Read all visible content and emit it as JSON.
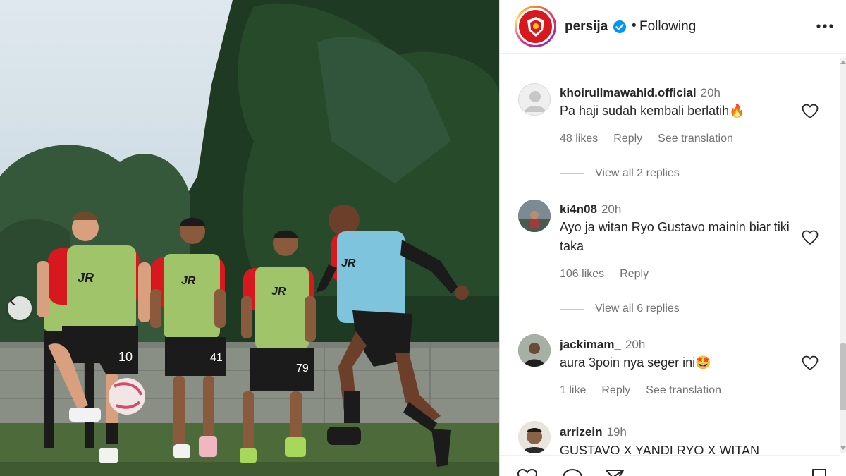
{
  "photo": {
    "alt_jersey_brand": "JR",
    "player_numbers": [
      "10",
      "41",
      "79"
    ]
  },
  "carousel": {
    "prev_icon": "chevron-left-icon"
  },
  "post_header": {
    "username": "persija",
    "verified_icon": "verified-badge-icon",
    "separator": "•",
    "follow_status": "Following",
    "more_icon": "more-horizontal-icon",
    "brand_color": "#d7191f"
  },
  "comments": [
    {
      "username": "khoirullmawahid.official",
      "time": "20h",
      "text": "Pa haji sudah kembali berlatih🔥",
      "likes": "48 likes",
      "reply": "Reply",
      "translation": "See translation",
      "view_replies": "View all 2 replies",
      "avatar": "default-avatar-icon"
    },
    {
      "username": "ki4n08",
      "time": "20h",
      "text": "Ayo ja witan Ryo Gustavo mainin biar tiki taka",
      "likes": "106 likes",
      "reply": "Reply",
      "view_replies": "View all 6 replies",
      "avatar": "photo-avatar"
    },
    {
      "username": "jackimam_",
      "time": "20h",
      "text": "aura 3poin nya seger ini🤩",
      "likes": "1 like",
      "reply": "Reply",
      "translation": "See translation",
      "avatar": "photo-avatar"
    },
    {
      "username": "arrizein",
      "time": "19h",
      "text": "GUSTAVO X YANDI RYO X WITAN",
      "avatar": "photo-avatar"
    }
  ],
  "actions": {
    "like_icon": "heart-icon",
    "comment_icon": "comment-icon",
    "share_icon": "send-icon",
    "save_icon": "bookmark-icon"
  },
  "colors": {
    "text_primary": "#262626",
    "text_secondary": "#737373",
    "verified_blue": "#0095f6"
  }
}
